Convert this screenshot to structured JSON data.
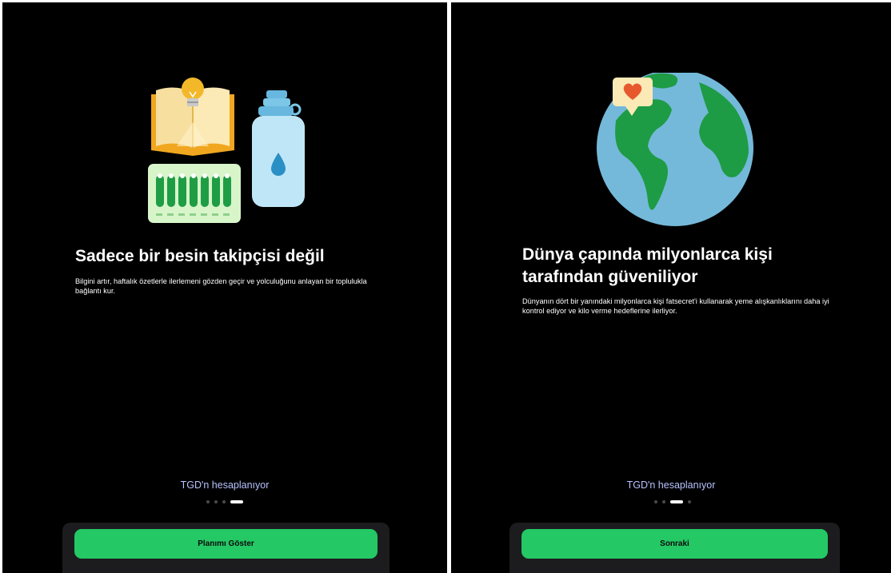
{
  "screens": [
    {
      "title": "Sadece bir besin takipçisi değil",
      "body": "Bilgini artır, haftalık özetlerle ilerlemeni gözden geçir ve yolculuğunu anlayan bir toplulukla bağlantı kur.",
      "status": "TGD'n hesaplanıyor",
      "active_dot": 4,
      "button_label": "Planımı Göster",
      "illustration": "book-bulb-bottle-icon"
    },
    {
      "title": "Dünya çapında milyonlarca kişi tarafından güveniliyor",
      "body": "Dünyanın dört bir yanındaki milyonlarca kişi fatsecret'i kullanarak yeme alışkanlıklarını daha iyi kontrol ediyor ve kilo verme hedeflerine ilerliyor.",
      "status": "TGD'n hesaplanıyor",
      "active_dot": 3,
      "button_label": "Sonraki",
      "illustration": "globe-heart-icon"
    }
  ],
  "colors": {
    "background": "#000000",
    "accent_green": "#24c865",
    "status_text": "#b9c3ff",
    "sheet": "#1c1c1e"
  }
}
